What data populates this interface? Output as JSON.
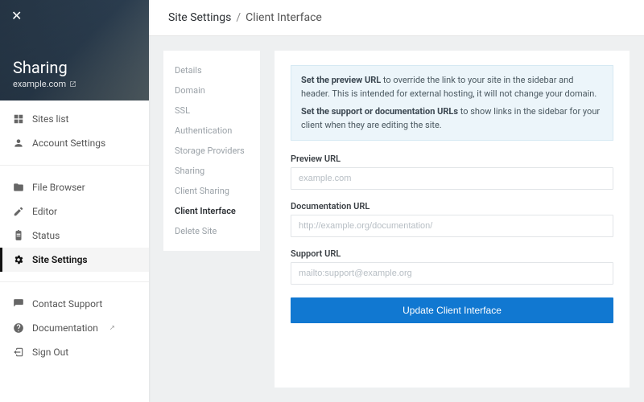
{
  "hero": {
    "title": "Sharing",
    "subtitle": "example.com"
  },
  "sidebar": {
    "group1": [
      {
        "label": "Sites list",
        "icon": "grid"
      },
      {
        "label": "Account Settings",
        "icon": "account"
      }
    ],
    "group2": [
      {
        "label": "File Browser",
        "icon": "folder"
      },
      {
        "label": "Editor",
        "icon": "pencil"
      },
      {
        "label": "Status",
        "icon": "clipboard"
      },
      {
        "label": "Site Settings",
        "icon": "gear",
        "active": true
      }
    ],
    "group3": [
      {
        "label": "Contact Support",
        "icon": "chat"
      },
      {
        "label": "Documentation",
        "icon": "help",
        "external": true
      },
      {
        "label": "Sign Out",
        "icon": "signout"
      }
    ]
  },
  "breadcrumb": {
    "a": "Site Settings",
    "sep": "/",
    "b": "Client Interface"
  },
  "subnav": [
    "Details",
    "Domain",
    "SSL",
    "Authentication",
    "Storage Providers",
    "Sharing",
    "Client Sharing",
    "Client Interface",
    "Delete Site"
  ],
  "subnav_current": "Client Interface",
  "notice": {
    "p1a": "Set the preview URL",
    "p1b": " to override the link to your site in the sidebar and header. This is intended for external hosting, it will not change your domain.",
    "p2a": "Set the support or documentation URLs",
    "p2b": " to show links in the sidebar for your client when they are editing the site."
  },
  "fields": {
    "preview": {
      "label": "Preview URL",
      "placeholder": "example.com",
      "value": ""
    },
    "docs": {
      "label": "Documentation URL",
      "placeholder": "http://example.org/documentation/",
      "value": ""
    },
    "support": {
      "label": "Support URL",
      "placeholder": "mailto:support@example.org",
      "value": ""
    }
  },
  "submit_label": "Update Client Interface"
}
